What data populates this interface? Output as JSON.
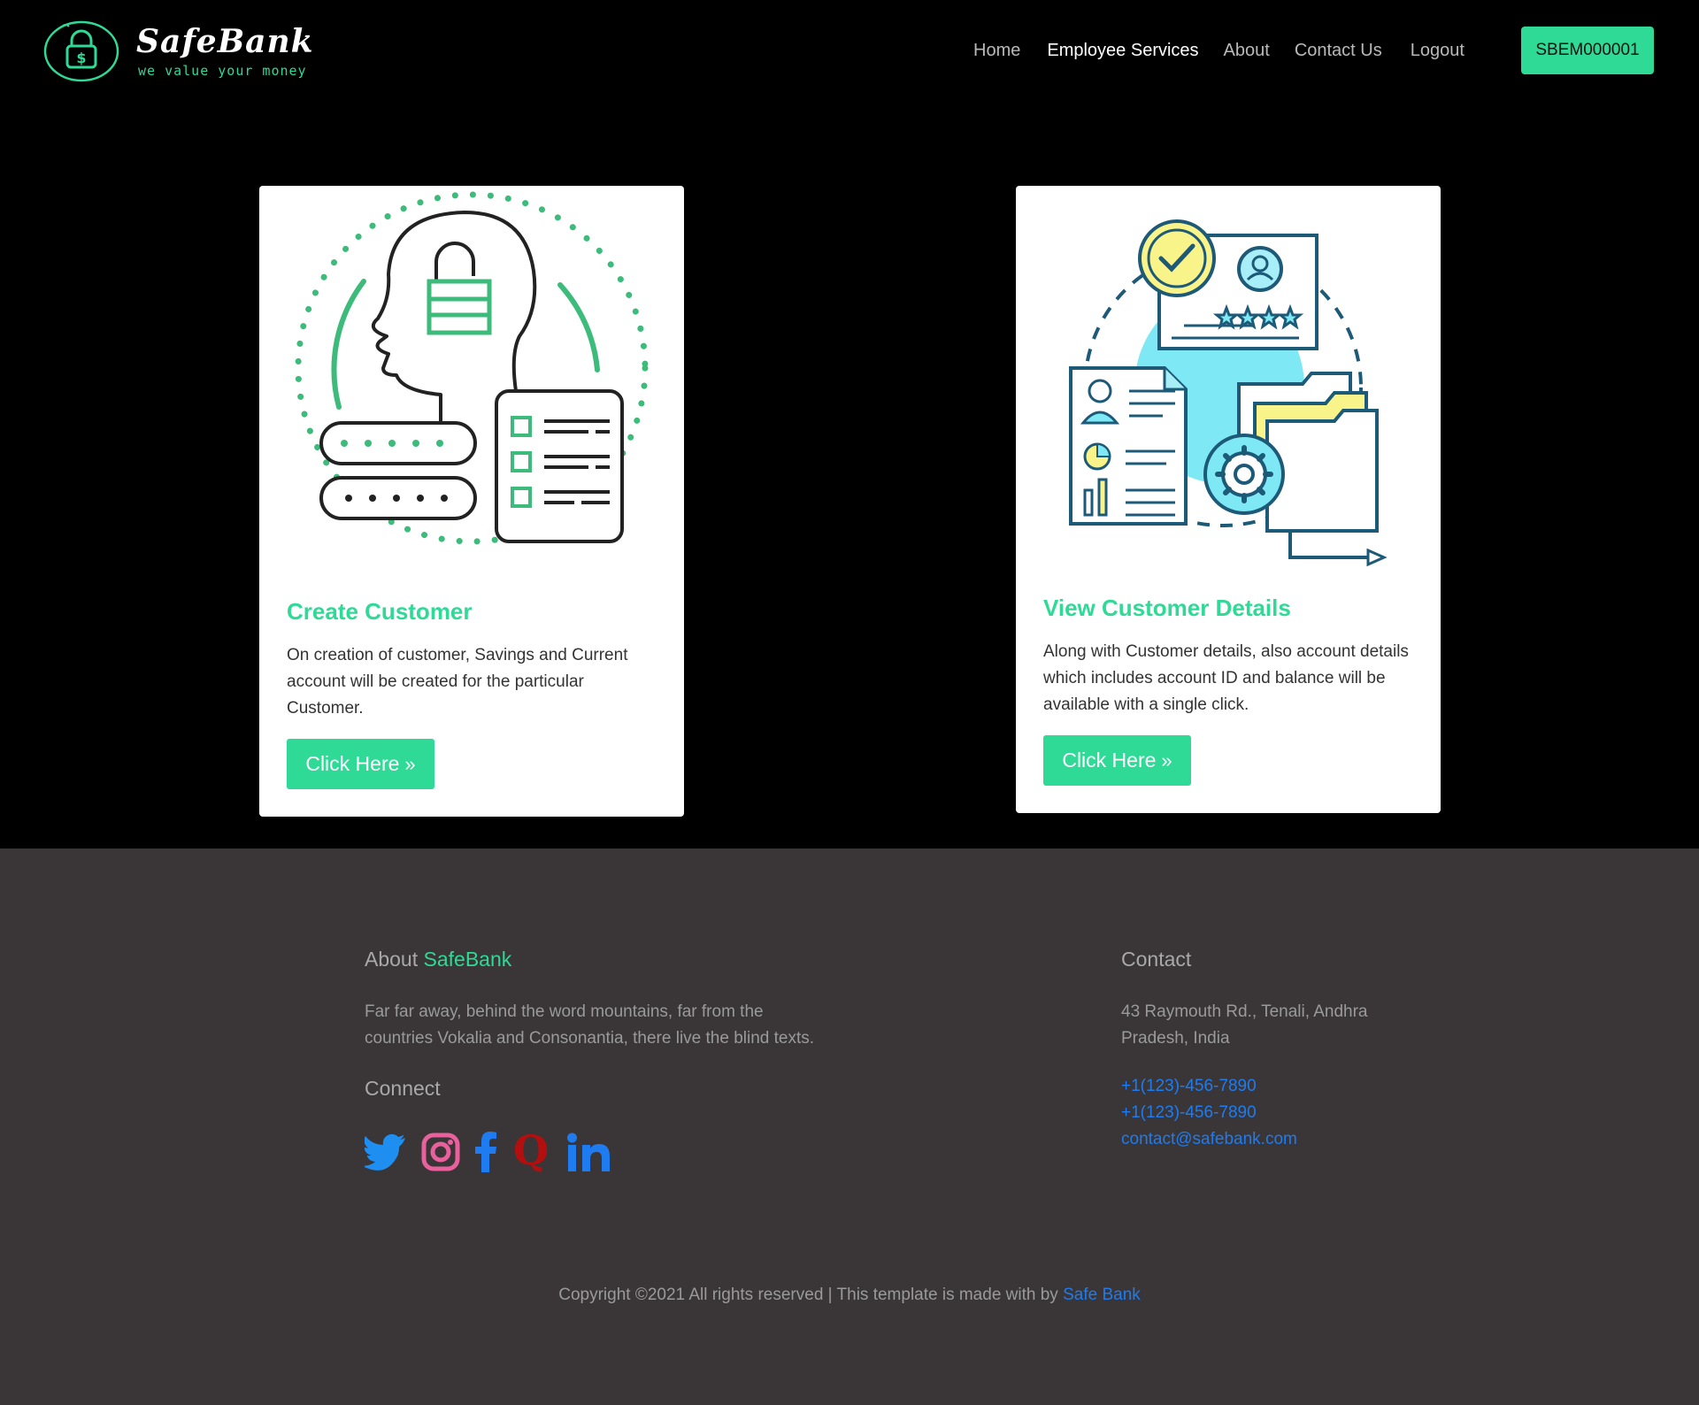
{
  "header": {
    "brand_name": "SafeBank",
    "brand_tagline": "we value your money",
    "nav": [
      {
        "label": "Home"
      },
      {
        "label": "Employee Services"
      },
      {
        "label": "About"
      },
      {
        "label": "Contact Us"
      },
      {
        "label": "Logout"
      }
    ],
    "active_nav": "Employee Services",
    "user_id": "SBEM000001"
  },
  "cards": [
    {
      "title": "Create Customer",
      "description": "On creation of customer, Savings and Current account will be created for the particular Customer.",
      "button_label": "Click Here",
      "illustration": "secure-user-login-icon"
    },
    {
      "title": "View Customer Details",
      "description": "Along with Customer details, also account details which includes account ID and balance will be available with a single click.",
      "button_label": "Click Here",
      "illustration": "customer-profile-documents-icon"
    }
  ],
  "footer": {
    "about_prefix": "About",
    "about_brand": "SafeBank",
    "about_text": "Far far away, behind the word mountains, far from the countries Vokalia and Consonantia, there live the blind texts.",
    "connect_heading": "Connect",
    "social": [
      "twitter-icon",
      "instagram-icon",
      "facebook-icon",
      "quora-icon",
      "linkedin-icon"
    ],
    "contact_heading": "Contact",
    "address": "43 Raymouth Rd., Tenali, Andhra Pradesh, India",
    "phone_1": "+1(123)-456-7890",
    "phone_2": "+1(123)-456-7890",
    "email": "contact@safebank.com",
    "copyright_text": "Copyright ©2021 All rights reserved | This template is made with by",
    "copyright_link": "Safe Bank"
  },
  "colors": {
    "accent": "#2fd996",
    "background": "#000000",
    "footer_bg": "#3a3536",
    "link": "#1e7cf0"
  }
}
